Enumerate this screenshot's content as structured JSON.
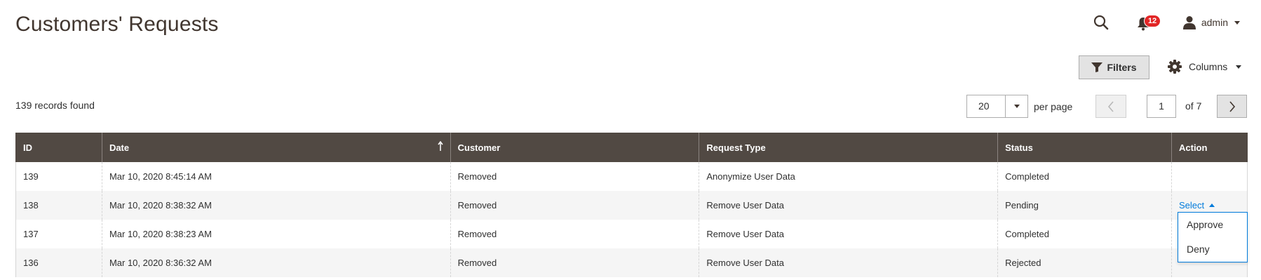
{
  "page": {
    "title": "Customers' Requests"
  },
  "header": {
    "notification_count": "12",
    "user_name": "admin"
  },
  "toolbar": {
    "filters_label": "Filters",
    "columns_label": "Columns",
    "records_found": "139 records found",
    "per_page_value": "20",
    "per_page_label": "per page",
    "current_page": "1",
    "total_pages_label": "of 7"
  },
  "table": {
    "columns": [
      "ID",
      "Date",
      "Customer",
      "Request Type",
      "Status",
      "Action"
    ],
    "sorted_column": "Date",
    "sort_direction": "ascending",
    "rows": [
      {
        "id": "139",
        "date": "Mar 10, 2020 8:45:14 AM",
        "customer": "Removed",
        "request_type": "Anonymize User Data",
        "status": "Completed",
        "action": ""
      },
      {
        "id": "138",
        "date": "Mar 10, 2020 8:38:32 AM",
        "customer": "Removed",
        "request_type": "Remove User Data",
        "status": "Pending",
        "action": "Select"
      },
      {
        "id": "137",
        "date": "Mar 10, 2020 8:38:23 AM",
        "customer": "Removed",
        "request_type": "Remove User Data",
        "status": "Completed",
        "action": ""
      },
      {
        "id": "136",
        "date": "Mar 10, 2020 8:36:32 AM",
        "customer": "Removed",
        "request_type": "Remove User Data",
        "status": "Rejected",
        "action": ""
      }
    ]
  },
  "action_menu": {
    "items": [
      "Approve",
      "Deny"
    ]
  },
  "colors": {
    "header_bg": "#514943",
    "link": "#007bdb",
    "badge": "#e22626"
  },
  "icons": {
    "search": "search-icon",
    "notifications": "bell-icon",
    "user": "user-icon",
    "filter": "funnel-icon",
    "columns": "gear-icon",
    "prev": "chevron-left-icon",
    "next": "chevron-right-icon",
    "sort": "arrow-up-icon"
  }
}
